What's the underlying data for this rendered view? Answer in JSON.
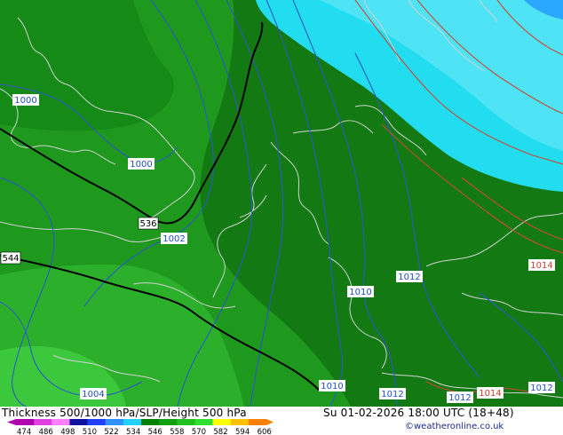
{
  "title": "Thickness 500/1000 hPa/SLP/Height 500 hPa",
  "valid_time": "Su 01-02-2026 18:00 UTC (18+48)",
  "credit": "©weatheronline.co.uk",
  "colors": {
    "land_outline": "#d8d8d8",
    "isobar": "#1f4fbf",
    "isobar_high": "#c84030",
    "height_line": "#000000",
    "dark_green": "#137a13",
    "mid_green": "#1fa01f",
    "light_green": "#32b832",
    "bright_green": "#40c840",
    "cyan": "#22dcf0",
    "light_cyan": "#5ae8f8"
  },
  "height_labels": [
    {
      "text": "536"
    },
    {
      "text": "544"
    }
  ],
  "isobar_labels": [
    {
      "text": "1000"
    },
    {
      "text": "1000"
    },
    {
      "text": "1002"
    },
    {
      "text": "1004"
    },
    {
      "text": "1010"
    },
    {
      "text": "1010"
    },
    {
      "text": "1012"
    },
    {
      "text": "1012"
    },
    {
      "text": "1012"
    },
    {
      "text": "1012"
    },
    {
      "text": "1014"
    },
    {
      "text": "1014"
    }
  ],
  "scale": {
    "labels": [
      "474",
      "486",
      "498",
      "510",
      "522",
      "534",
      "546",
      "558",
      "570",
      "582",
      "594",
      "606"
    ],
    "colors": [
      "#b000b0",
      "#e040e0",
      "#ff80ff",
      "#1010a0",
      "#2040ff",
      "#3090ff",
      "#20d0ff",
      "#008000",
      "#10a010",
      "#20c020",
      "#30e030",
      "#ffff00",
      "#ffc000",
      "#ff8000"
    ]
  }
}
